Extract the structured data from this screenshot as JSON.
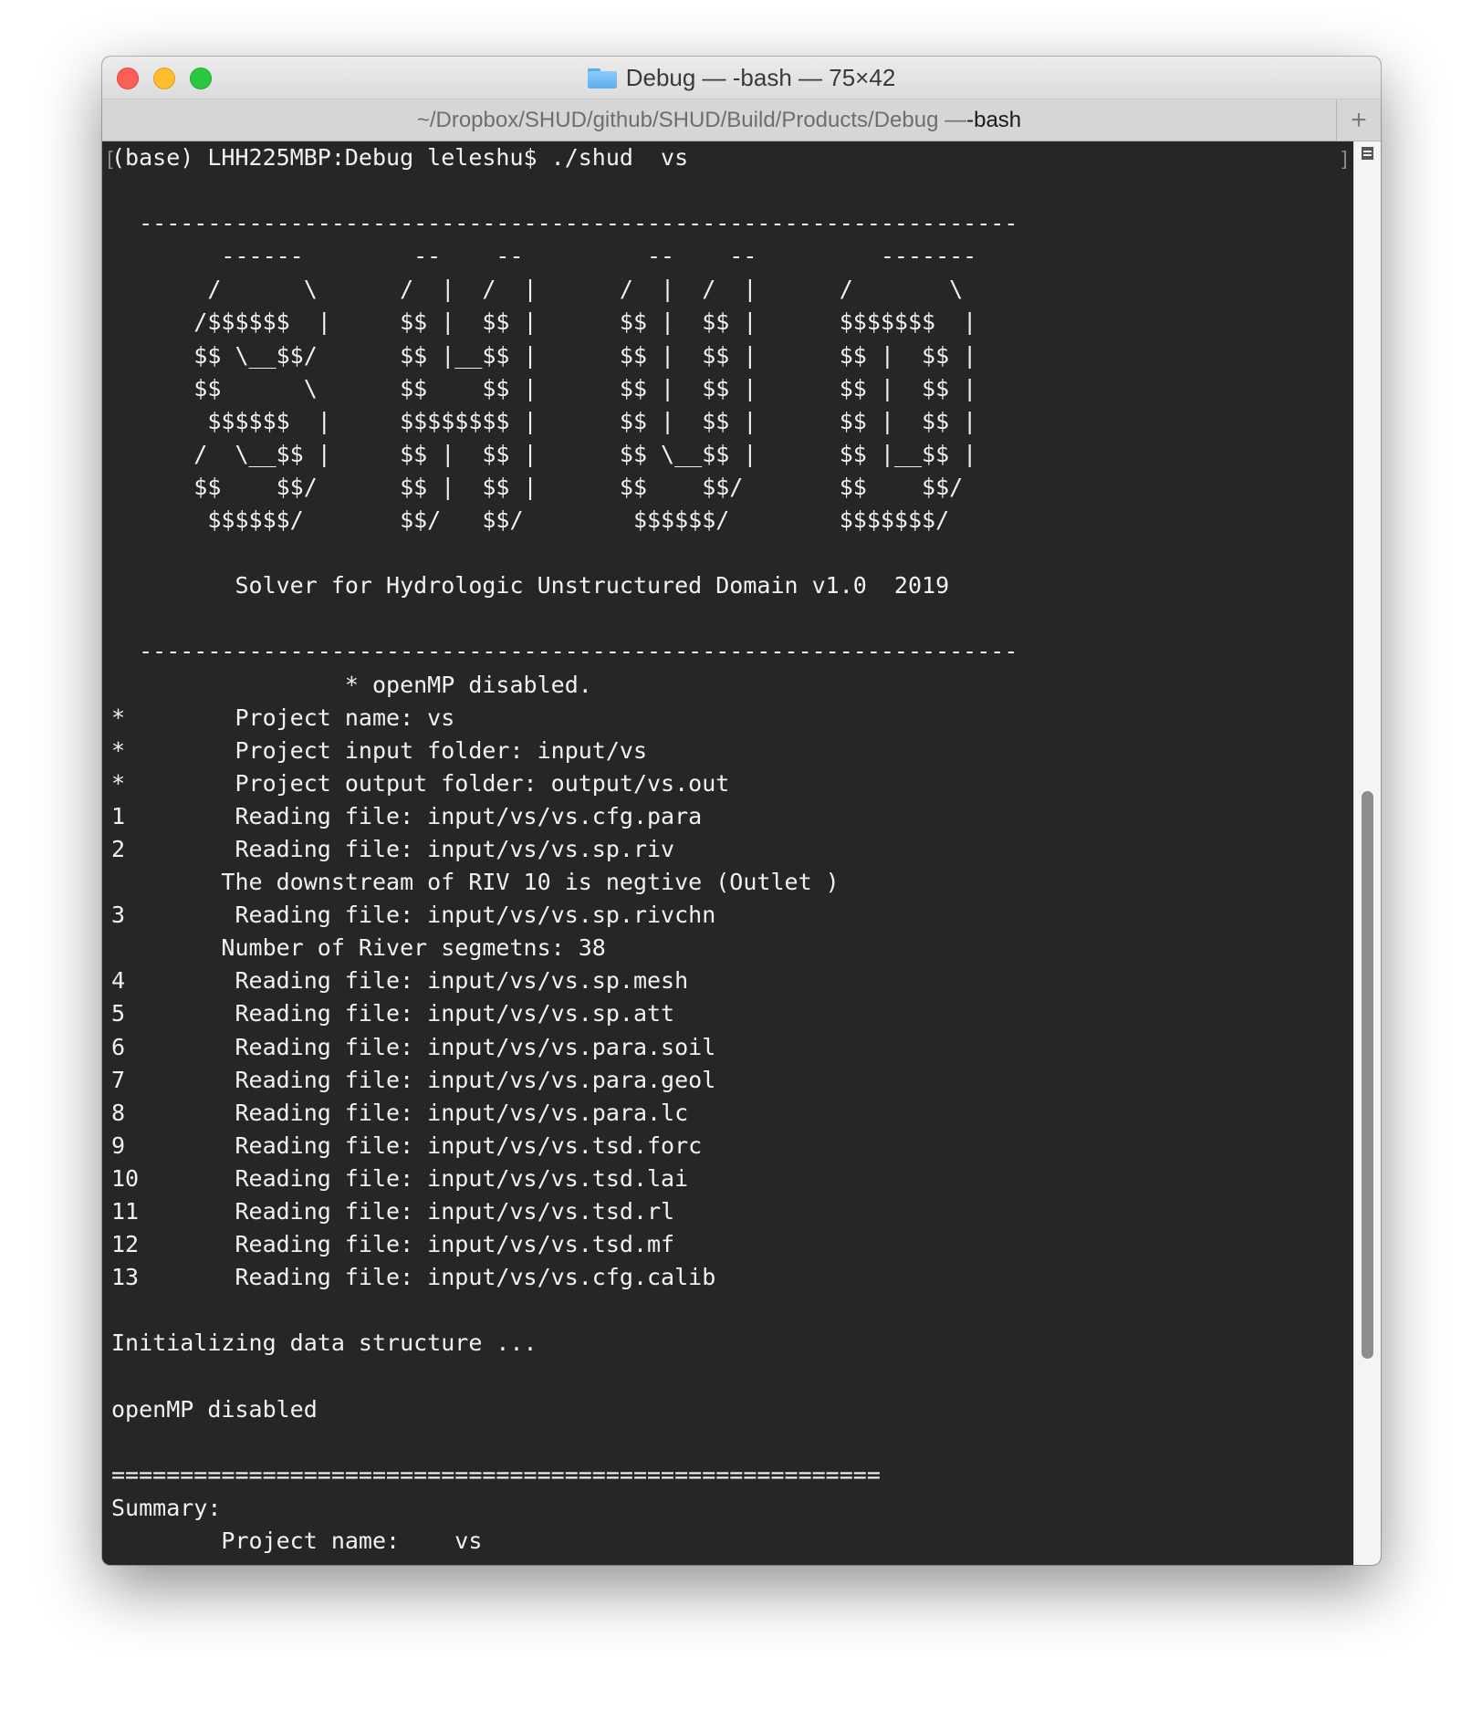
{
  "window": {
    "title": "Debug — -bash — 75×42",
    "tab_path": "~/Dropbox/SHUD/github/SHUD/Build/Products/Debug — ",
    "tab_cmd": "-bash",
    "new_tab_label": "+"
  },
  "terminal": {
    "lines": [
      "(base) LHH225MBP:Debug leleshu$ ./shud  vs",
      "",
      "  ----------------------------------------------------------------",
      "        ------        --    --         --    --         -------",
      "       /      \\      /  |  /  |      /  |  /  |      /       \\",
      "      /$$$$$$  |     $$ |  $$ |      $$ |  $$ |      $$$$$$$  |",
      "      $$ \\__$$/      $$ |__$$ |      $$ |  $$ |      $$ |  $$ |",
      "      $$      \\      $$    $$ |      $$ |  $$ |      $$ |  $$ |",
      "       $$$$$$  |     $$$$$$$$ |      $$ |  $$ |      $$ |  $$ |",
      "      /  \\__$$ |     $$ |  $$ |      $$ \\__$$ |      $$ |__$$ |",
      "      $$    $$/      $$ |  $$ |      $$    $$/       $$    $$/",
      "       $$$$$$/       $$/   $$/        $$$$$$/        $$$$$$$/",
      "",
      "         Solver for Hydrologic Unstructured Domain v1.0  2019",
      "",
      "  ----------------------------------------------------------------",
      "                 * openMP disabled.",
      "*        Project name: vs",
      "*        Project input folder: input/vs",
      "*        Project output folder: output/vs.out",
      "1        Reading file: input/vs/vs.cfg.para",
      "2        Reading file: input/vs/vs.sp.riv",
      "        The downstream of RIV 10 is negtive (Outlet )",
      "3        Reading file: input/vs/vs.sp.rivchn",
      "        Number of River segmetns: 38",
      "4        Reading file: input/vs/vs.sp.mesh",
      "5        Reading file: input/vs/vs.sp.att",
      "6        Reading file: input/vs/vs.para.soil",
      "7        Reading file: input/vs/vs.para.geol",
      "8        Reading file: input/vs/vs.para.lc",
      "9        Reading file: input/vs/vs.tsd.forc",
      "10       Reading file: input/vs/vs.tsd.lai",
      "11       Reading file: input/vs/vs.tsd.rl",
      "12       Reading file: input/vs/vs.tsd.mf",
      "13       Reading file: input/vs/vs.cfg.calib",
      "",
      "Initializing data structure ...",
      "",
      "openMP disabled",
      "",
      "========================================================",
      "Summary:",
      "        Project name:    vs"
    ]
  },
  "colors": {
    "terminal_bg": "#262626",
    "terminal_fg": "#f2f2f2",
    "close": "#fd5f57",
    "minimize": "#febc2e",
    "zoom": "#29c840"
  }
}
